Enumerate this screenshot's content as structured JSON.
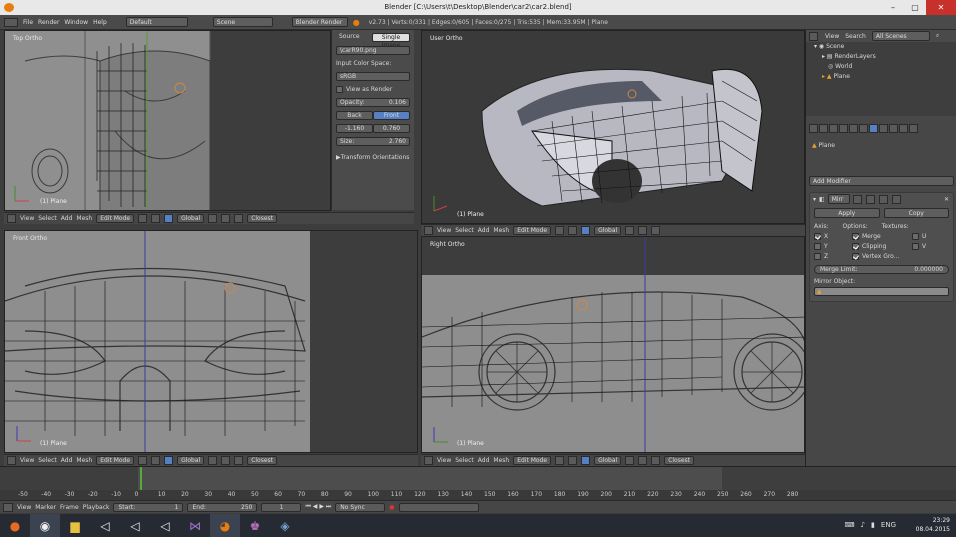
{
  "window": {
    "title": "Blender [C:\\Users\\t\\Desktop\\Blender\\car2\\car2.blend]"
  },
  "info_bar": {
    "menus": [
      "File",
      "Render",
      "Window",
      "Help"
    ],
    "layout": "Default",
    "scene": "Scene",
    "engine": "Blender Render",
    "stats": "v2.73 | Verts:0/331 | Edges:0/605 | Faces:0/275 | Tris:535 | Mem:33.95M | Plane"
  },
  "viewports": {
    "top": {
      "label": "Top Ortho",
      "object": "(1) Plane"
    },
    "user": {
      "label": "User Ortho",
      "object": "(1) Plane"
    },
    "front": {
      "label": "Front Ortho",
      "object": "(1) Plane"
    },
    "right": {
      "label": "Right Ortho",
      "object": "(1) Plane"
    }
  },
  "viewport_header": {
    "menus": [
      "View",
      "Select",
      "Add",
      "Mesh"
    ],
    "mode": "Edit Mode",
    "orientation": "Global",
    "snap": "Closest"
  },
  "bg_panel": {
    "tab_source": "Source",
    "tab_single": "Single Image",
    "image": "\\carR90.png",
    "input_color_space": "Input Color Space:",
    "color_space": "sRGB",
    "view_as_render": "View as Render",
    "opacity_label": "Opacity:",
    "opacity": "0.106",
    "back": "Back",
    "front": "Front",
    "x": "-1.160",
    "y": "0.760",
    "size_label": "Size:",
    "size": "2.760",
    "transform_orientations": "Transform Orientations"
  },
  "outliner": {
    "menus": [
      "View",
      "Search"
    ],
    "filter": "All Scenes",
    "items": [
      "Scene",
      "RenderLayers",
      "World",
      "Plane"
    ]
  },
  "properties": {
    "object": "Plane",
    "add_modifier": "Add Modifier",
    "modifier_name": "Mirr",
    "apply": "Apply",
    "copy": "Copy",
    "axis": "Axis:",
    "options": "Options:",
    "textures": "Textures:",
    "x": "X",
    "y": "Y",
    "z": "Z",
    "merge": "Merge",
    "clipping": "Clipping",
    "vertex_groups": "Vertex Gro...",
    "u": "U",
    "v": "V",
    "merge_limit_label": "Merge Limit:",
    "merge_limit": "0.000000",
    "mirror_object": "Mirror Object:"
  },
  "timeline": {
    "ticks": [
      "-50",
      "-40",
      "-30",
      "-20",
      "-10",
      "0",
      "10",
      "20",
      "30",
      "40",
      "50",
      "60",
      "70",
      "80",
      "90",
      "100",
      "110",
      "120",
      "130",
      "140",
      "150",
      "160",
      "170",
      "180",
      "190",
      "200",
      "210",
      "220",
      "230",
      "240",
      "250",
      "260",
      "270",
      "280"
    ],
    "menus": [
      "View",
      "Marker",
      "Frame",
      "Playback"
    ],
    "start_label": "Start:",
    "start": "1",
    "end_label": "End:",
    "end": "250",
    "current": "1",
    "sync": "No Sync"
  },
  "taskbar": {
    "lang": "ENG",
    "time": "23:29",
    "date": "08.04.2015"
  }
}
